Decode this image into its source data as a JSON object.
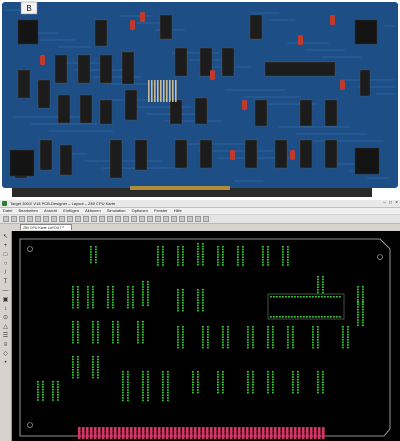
{
  "photo": {
    "label": "Photo of the original circuit board",
    "board_color": "#1d4f86",
    "chip_color": "#1c1c1c",
    "heatsink_color": "#141414",
    "capacitor_color": "#c0392b",
    "trace_color": "#2f66a6",
    "connector_color": "#b08d3a",
    "tag_text": "B"
  },
  "window": {
    "title": "Target 3001! V18 PCB-Designer – Layout – Z80 CPU Karte",
    "controls": [
      "–",
      "□",
      "×"
    ]
  },
  "menu": [
    "Datei",
    "Bearbeiten",
    "Ansicht",
    "Einfügen",
    "Aktionen",
    "Simulation",
    "Optionen",
    "Fenster",
    "Hilfe"
  ],
  "tab": {
    "label": "Z80 CPU Karte LAYOUT",
    "close": "×"
  },
  "tools": [
    "↖",
    "+",
    "□",
    "○",
    "/",
    "T",
    "—",
    "▣",
    "↕",
    "⊙",
    "△",
    "☰",
    "≡",
    "◇",
    "•"
  ],
  "layout": {
    "background": "#000000",
    "outline_color": "#bfbfbf",
    "pad_color": "#33cc33",
    "edge_connector_color": "#d6336c"
  }
}
